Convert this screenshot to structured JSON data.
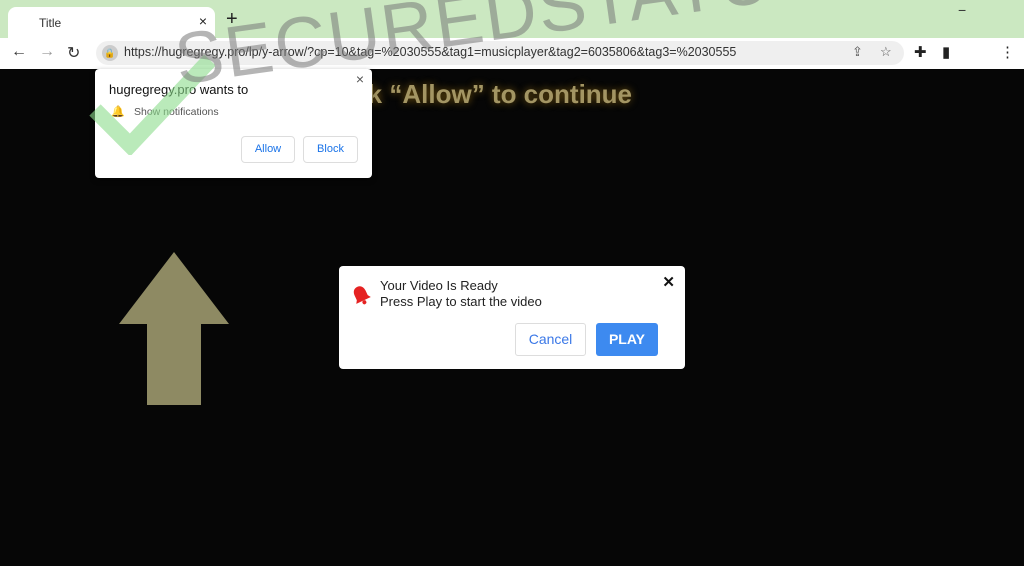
{
  "browser": {
    "tab_title": "Title",
    "tab_close": "×",
    "new_tab": "+",
    "minimize": "−",
    "url": "https://hugregregy.pro/lp/y-arrow/?cp=10&tag=%2030555&tag1=musicplayer&tag2=6035806&tag3=%2030555",
    "icons": [
      "back-icon",
      "forward-icon",
      "reload-icon",
      "lock-icon",
      "share-icon",
      "star-icon",
      "extensions-icon",
      "sidepanel-icon",
      "menu-icon"
    ]
  },
  "page": {
    "headline": "Click “Allow” to continue",
    "arrow_color": "#8e8a63"
  },
  "permission_prompt": {
    "title": "hugregregy.pro wants to",
    "permission": "Show notifications",
    "allow": "Allow",
    "block": "Block",
    "close": "×"
  },
  "dialog": {
    "title": "Your Video Is Ready",
    "subtitle": "Press Play to start the video",
    "cancel": "Cancel",
    "play": "PLAY",
    "close": "✕",
    "accent": "#3d8af0"
  },
  "watermark": "SECUREDSTATUS"
}
